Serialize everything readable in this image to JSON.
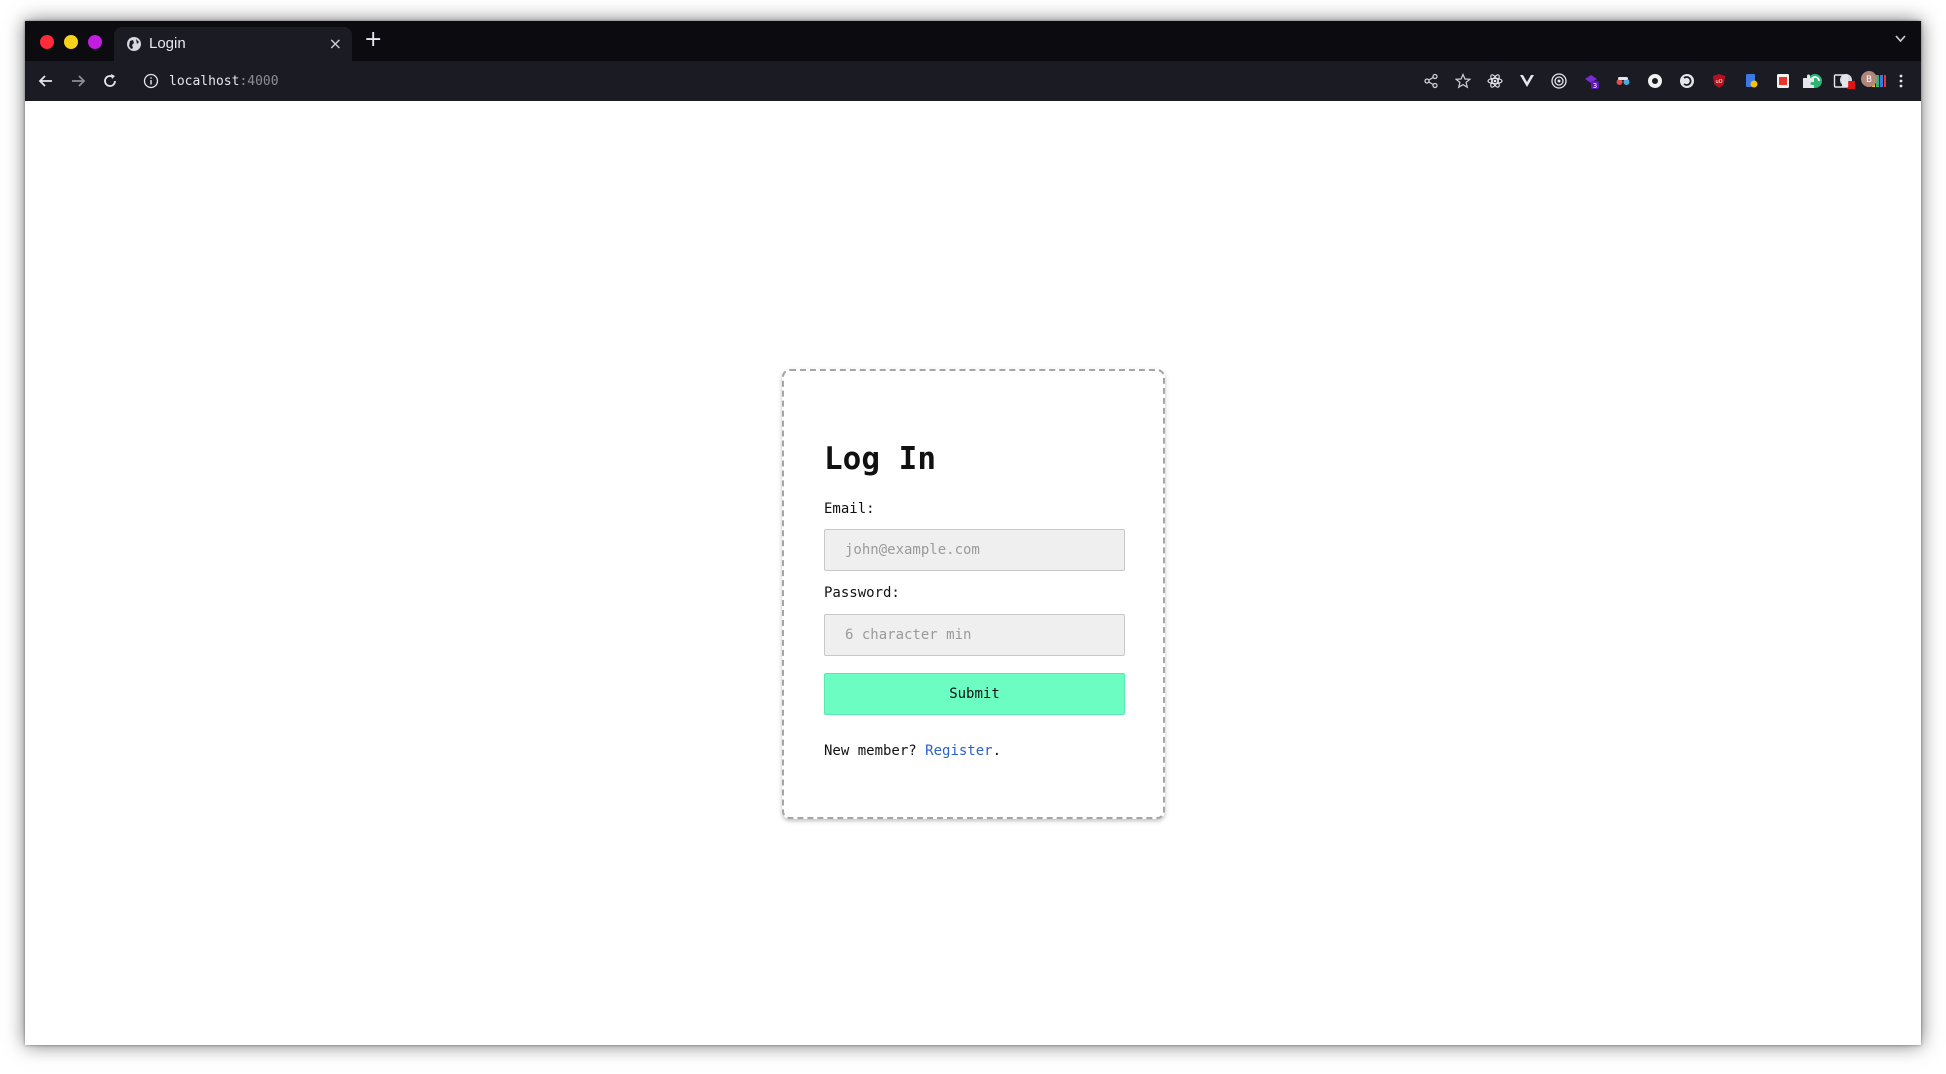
{
  "browser": {
    "tab_title": "Login",
    "tab_close": "×",
    "new_tab": "+",
    "url_host": "localhost",
    "url_port": ":4000",
    "profile_initial": "B",
    "extension_badge": "3"
  },
  "login": {
    "heading": "Log In",
    "email_label": "Email:",
    "email_placeholder": "john@example.com",
    "email_value": "",
    "password_label": "Password:",
    "password_placeholder": "6 character min",
    "password_value": "",
    "submit_label": "Submit",
    "register_prefix": "New member? ",
    "register_link": "Register",
    "register_suffix": "."
  },
  "colors": {
    "submit_bg": "#6bfdc2",
    "link": "#2b61c9",
    "input_bg": "#efefef",
    "toolbar_bg": "#1b1b24",
    "tabstrip_bg": "#0b0b10"
  }
}
